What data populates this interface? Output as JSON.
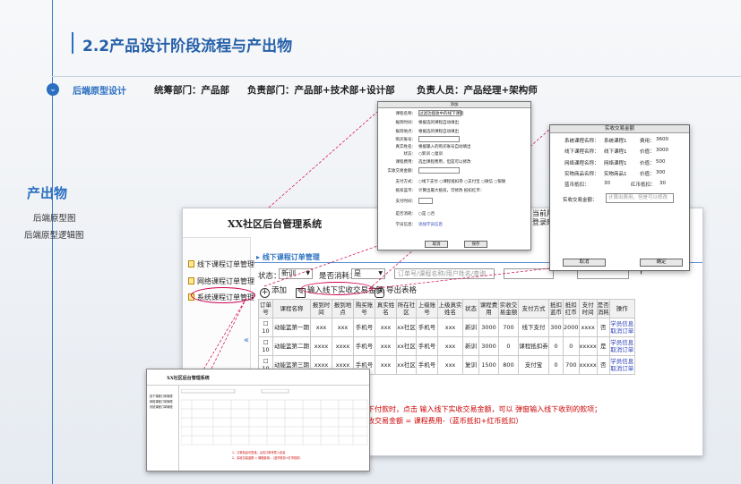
{
  "slide": {
    "title": "2.2产品设计阶段流程与产出物",
    "subtitle": "后端原型设计",
    "dept1": "统筹部门：产品部",
    "dept2": "负责部门：产品部+技术部+设计部",
    "dept3": "负责人员：产品经理+架构师",
    "output_title": "产出物",
    "output_items": [
      "后端原型图",
      "后端原型逻辑图"
    ]
  },
  "colors": {
    "accent": "#2a6fc0",
    "link": "#2a3fb8",
    "note": "#cc0000",
    "callout": "#d00050"
  },
  "app": {
    "title": "XX社区后台管理系统",
    "user_line1": "当前用户：",
    "user_line2": "登录时",
    "sidebar": [
      "线下课程订单管理",
      "网络课程订单管理",
      "系统课程订单管理"
    ],
    "collapse_icon": "«",
    "breadcrumb": "线下课程订单管理",
    "filters": {
      "status_label": "状态：",
      "status_value": "新训",
      "consume_label": "是否消耗：",
      "consume_value": "是",
      "search_placeholder": "订单号/课程名称/用户姓名/查询"
    },
    "toolbar": {
      "add": "添加",
      "enter_amount": "输入线下实收交易金额",
      "export": "导出表格"
    },
    "table": {
      "headers": [
        "订单号",
        "课程名称",
        "报到时间",
        "报到地点",
        "购买账号",
        "真实姓名",
        "所在社区",
        "上级账号",
        "上级真实姓名",
        "状态",
        "课程费用",
        "实收交易金额",
        "支付方式",
        "抵扣蓝币",
        "抵扣红币",
        "支付时间",
        "是否消耗",
        "操作"
      ],
      "rows": [
        [
          "10",
          "动能篮第一期",
          "xxx",
          "xxx",
          "手机号",
          "xxx",
          "xx社区",
          "手机号",
          "xxx",
          "新训",
          "3000",
          "700",
          "线下支付",
          "300",
          "2000",
          "xxxx",
          "否",
          "学员信息",
          "取消订单"
        ],
        [
          "10",
          "动能篮第二期",
          "xxxx",
          "xxxx",
          "手机号",
          "xxx",
          "xx社区",
          "手机号",
          "xxx",
          "新训",
          "3000",
          "0",
          "课程抵扣券",
          "0",
          "0",
          "xxxxx",
          "是",
          "学员信息",
          "取消订单"
        ],
        [
          "10",
          "动能篮第三期",
          "xxxx",
          "xxxx",
          "手机号",
          "xxx",
          "xx社区",
          "手机号",
          "xxx",
          "复训",
          "1500",
          "800",
          "支付宝",
          "0",
          "700",
          "xxxxx",
          "否",
          "学员信息",
          "取消订单"
        ]
      ]
    },
    "notes": [
      "下付款时，点击 输入线下实收交易金额，可以 弹窗输入线下收到的款项；",
      "收交易金额 = 课程费用-（蓝币抵扣+红币抵扣）"
    ]
  },
  "dialog_add": {
    "title": "添加",
    "fields": [
      {
        "label": "课程名称：",
        "value": "过滤功能收中的线下课程"
      },
      {
        "label": "报到时间：",
        "value": "根据选的课程自动填出"
      },
      {
        "label": "报到地点：",
        "value": "根据选的课程自动填出"
      },
      {
        "label": "购买账号：",
        "value": ""
      },
      {
        "label": "真实姓名：",
        "value": "根据输入的购买账号自动填出"
      },
      {
        "label": "状态：",
        "value": "○新训  ○复训"
      },
      {
        "label": "课程费用：",
        "value": "选出课程费用，但是可以修改"
      },
      {
        "label": "实收交易金额：",
        "value": ""
      },
      {
        "label": "支付方式：",
        "value": "○线下支付 ○课程抵扣券 ○支付宝 ○微信 ○银联"
      },
      {
        "label": "抵扣蓝币：",
        "value": "计算出最大抵扣，可修改     抵扣红币："
      },
      {
        "label": "支付时间：",
        "value": ""
      },
      {
        "label": "是否消耗：",
        "value": "○是    ○否"
      },
      {
        "label": "学员信息：",
        "value": "添加学员信息"
      }
    ],
    "cancel": "取消",
    "save": "保存"
  },
  "dialog_amount": {
    "title": "实收交易金额",
    "rows": [
      {
        "label": "系统课程名称：",
        "value": "系统课程1",
        "extra_label": "费用：",
        "extra_value": "3600"
      },
      {
        "label": "线下课程名称：",
        "value": "线下课程1",
        "extra_label": "价值：",
        "extra_value": "3000"
      },
      {
        "label": "网络课程名称：",
        "value": "网络课程1",
        "extra_label": "价值：",
        "extra_value": "500"
      },
      {
        "label": "实物商品名称：",
        "value": "实物商品1",
        "extra_label": "价值：",
        "extra_value": "300"
      }
    ],
    "blue_label": "蓝币抵扣：",
    "blue_value": "30",
    "red_label": "红币抵扣：",
    "red_value": "30",
    "amount_label": "实收交易金额：",
    "amount_placeholder": "计算出费用，但是可以修改",
    "cancel": "取消",
    "confirm": "确定"
  },
  "thumb": {
    "title": "XX社区后台管理系统",
    "sidebar": [
      "线下课程订单管理",
      "网络课程订单管理",
      "系统课程订单管理"
    ],
    "notes": [
      "1、订单信息可查找，点击订单号导入信息",
      "2、实收交易金额 = 课程费用 -（蓝币抵扣+红币抵扣）"
    ]
  }
}
